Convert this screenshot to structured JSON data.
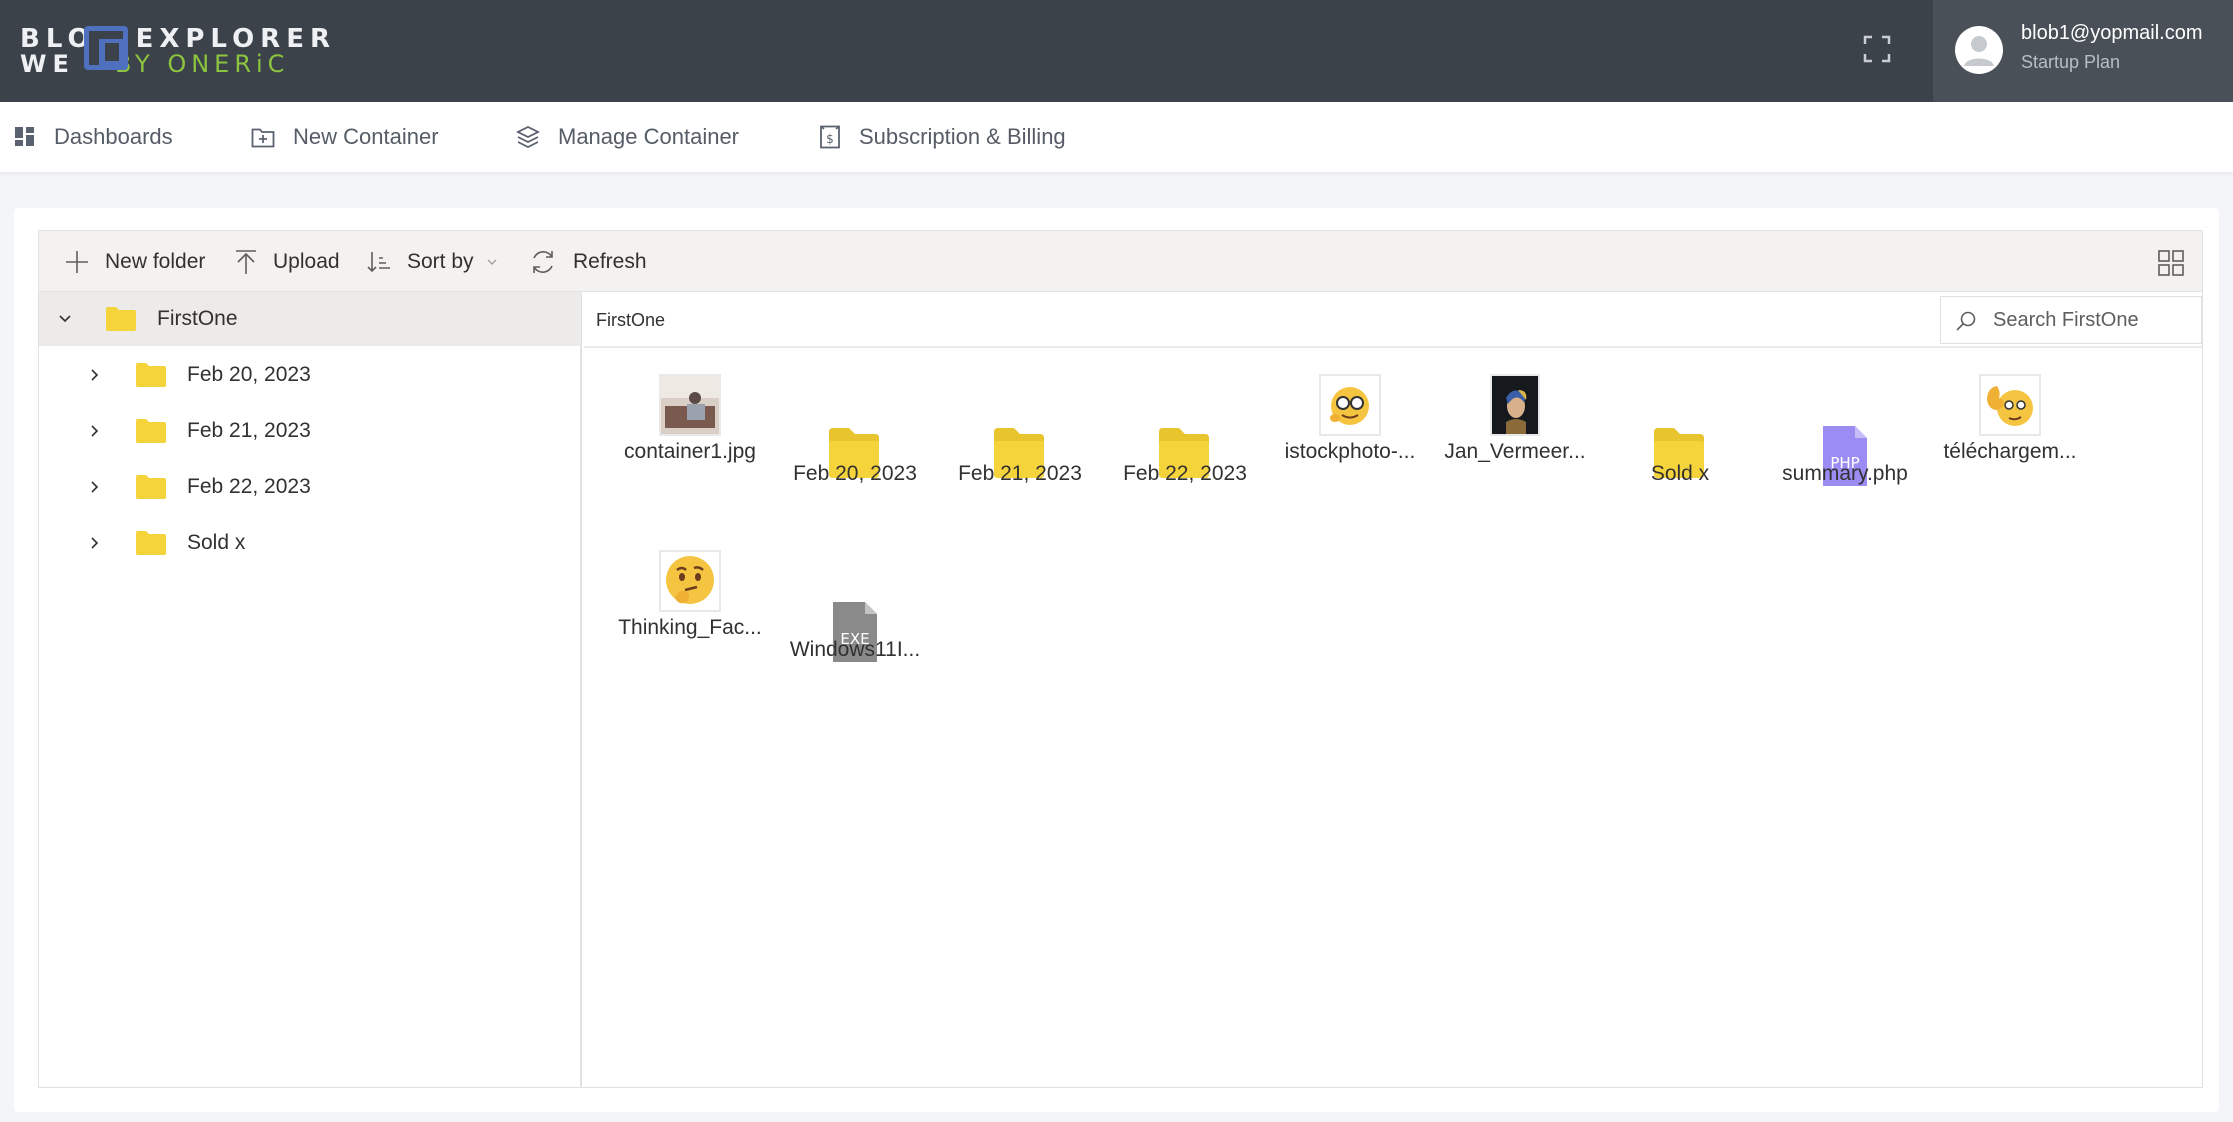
{
  "header": {
    "logo": {
      "row1_left": "BLO",
      "row1_right": "EXPLORER",
      "row2_left": "WE",
      "row2_right": "BY ONERiC"
    },
    "user": {
      "email": "blob1@yopmail.com",
      "plan": "Startup Plan"
    }
  },
  "nav": {
    "items": [
      {
        "label": "Dashboards",
        "icon": "dashboard-icon"
      },
      {
        "label": "New Container",
        "icon": "add-container-icon"
      },
      {
        "label": "Manage Container",
        "icon": "layers-icon"
      },
      {
        "label": "Subscription & Billing",
        "icon": "billing-icon"
      }
    ]
  },
  "toolbar": {
    "new_folder": "New folder",
    "upload": "Upload",
    "sort_by": "Sort by",
    "refresh": "Refresh"
  },
  "tree": {
    "root": "FirstOne",
    "children": [
      "Feb 20, 2023",
      "Feb 21, 2023",
      "Feb 22, 2023",
      "Sold x"
    ]
  },
  "breadcrumb": "FirstOne",
  "search": {
    "placeholder": "Search FirstOne"
  },
  "files": [
    {
      "name": "container1.jpg",
      "type": "image"
    },
    {
      "name": "Feb 20, 2023",
      "type": "folder"
    },
    {
      "name": "Feb 21, 2023",
      "type": "folder"
    },
    {
      "name": "Feb 22, 2023",
      "type": "folder"
    },
    {
      "name": "istockphoto-...",
      "type": "image"
    },
    {
      "name": "Jan_Vermeer...",
      "type": "image"
    },
    {
      "name": "Sold x",
      "type": "folder"
    },
    {
      "name": "summary.php",
      "type": "php",
      "badge": "PHP"
    },
    {
      "name": "téléchargem...",
      "type": "image"
    },
    {
      "name": "Thinking_Fac...",
      "type": "image"
    },
    {
      "name": "Windows11I...",
      "type": "exe",
      "badge": "EXE"
    }
  ],
  "colors": {
    "header_bg": "#3b4249",
    "folder": "#f5d33a",
    "logo_accent": "#8cc43f",
    "logo_mark": "#4f6fbf",
    "php_badge": "#9a8cf2",
    "exe_badge": "#8a8a8a"
  }
}
